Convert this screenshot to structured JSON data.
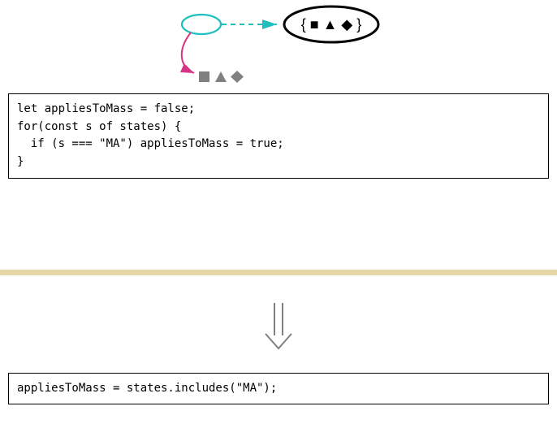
{
  "diagram": {
    "source_oval_empty": true,
    "target_oval_glyphs": "{ ■ ▲ ◆ }",
    "below_oval_glyphs": "■ ▲ ◆",
    "arrow_dashed_color": "#1fbfbf",
    "arrow_curved_color": "#d63384"
  },
  "code": {
    "block1_lines": [
      "let appliesToMass = false;",
      "for(const s of states) {",
      "  if (s === \"MA\") appliesToMass = true;",
      "}"
    ],
    "block2_lines": [
      "appliesToMass = states.includes(\"MA\");"
    ]
  },
  "divider_color": "#e6d6a8",
  "transform_arrow": "double-down-arrow"
}
